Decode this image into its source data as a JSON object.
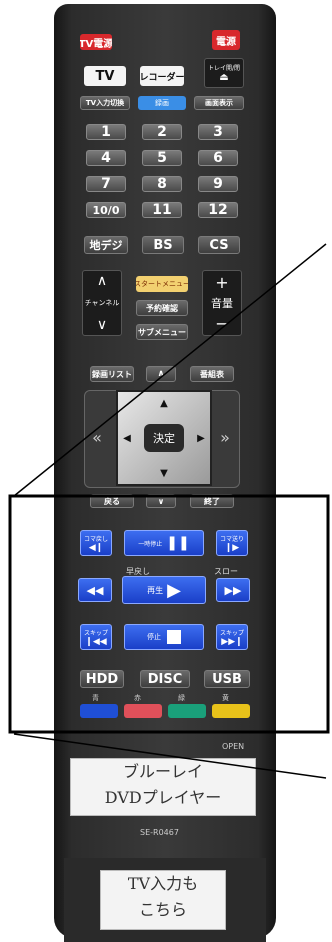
{
  "power": {
    "tv": "TV電源",
    "main": "電源"
  },
  "mode": {
    "tv": "TV",
    "recorder": "レコーダー",
    "tray": "トレイ開/閉"
  },
  "row3": {
    "tv_input": "TV入力切換",
    "blue_btn": "録画",
    "screen": "画面表示"
  },
  "numbers": [
    "1",
    "2",
    "3",
    "4",
    "5",
    "6",
    "7",
    "8",
    "9",
    "10/0",
    "11",
    "12"
  ],
  "broadcast": {
    "terrestrial": "地デジ",
    "bs": "BS",
    "cs": "CS"
  },
  "channel": "チャンネル",
  "volume": "音量",
  "menu": {
    "start": "スタートメニュー",
    "reserve": "予約確認",
    "sub": "サブメニュー"
  },
  "list": {
    "record_list": "録画リスト",
    "program_guide": "番組表"
  },
  "dpad": {
    "enter": "決定"
  },
  "nav": {
    "back": "戻る",
    "close": "終了"
  },
  "playback": {
    "frame_back": "コマ戻し",
    "pause": "一時停止",
    "frame_fwd": "コマ送り",
    "rewind_label": "早戻し",
    "play": "再生",
    "slow": "スロー",
    "skip_back": "スキップ",
    "stop": "停止",
    "skip_fwd": "スキップ"
  },
  "media": {
    "hdd": "HDD",
    "disc": "DISC",
    "usb": "USB"
  },
  "colors": {
    "blue": "青",
    "red": "赤",
    "green": "緑",
    "yellow": "黄",
    "blue_hex": "#1f4fd6",
    "red_hex": "#e0505a",
    "green_hex": "#1aa07a",
    "yellow_hex": "#e8c21a"
  },
  "open": "OPEN",
  "label_top": {
    "line1": "ブルーレイ",
    "line2": "DVDプレイヤー"
  },
  "model": "SE-R0467",
  "label_bottom": {
    "line1": "TV入力も",
    "line2": "こちら"
  }
}
